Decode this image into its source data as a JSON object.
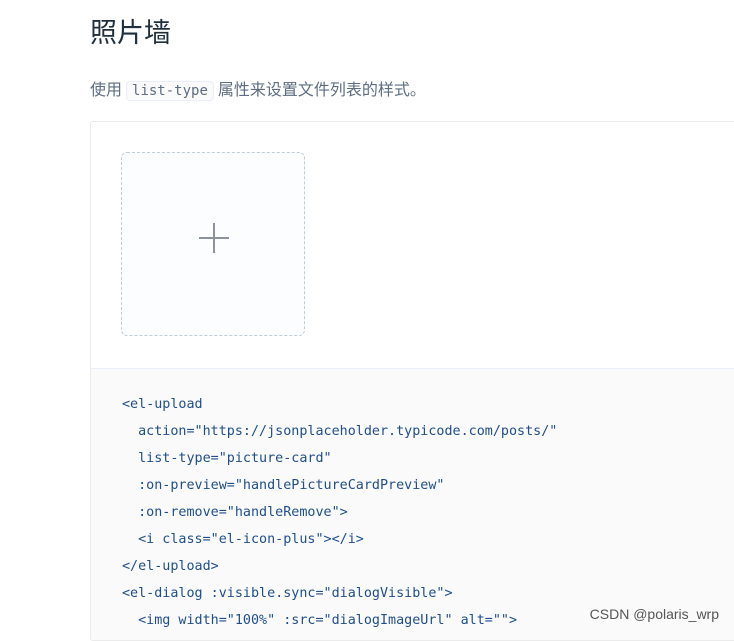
{
  "section": {
    "title": "照片墙",
    "desc_before": "使用",
    "desc_code": "list-type",
    "desc_after": "属性来设置文件列表的样式。"
  },
  "upload": {
    "icon": "plus-icon"
  },
  "code": {
    "lines": [
      "<el-upload",
      "  action=\"https://jsonplaceholder.typicode.com/posts/\"",
      "  list-type=\"picture-card\"",
      "  :on-preview=\"handlePictureCardPreview\"",
      "  :on-remove=\"handleRemove\">",
      "  <i class=\"el-icon-plus\"></i>",
      "</el-upload>",
      "<el-dialog :visible.sync=\"dialogVisible\">",
      "  <img width=\"100%\" :src=\"dialogImageUrl\" alt=\"\">"
    ]
  },
  "watermark": "CSDN @polaris_wrp",
  "colors": {
    "title": "#1f2f3d",
    "desc": "#5e6d82",
    "code_text": "#1f4e8c",
    "card_border": "#c0ccda",
    "card_bg": "#fbfdff",
    "meta_bg": "#fafafa"
  }
}
